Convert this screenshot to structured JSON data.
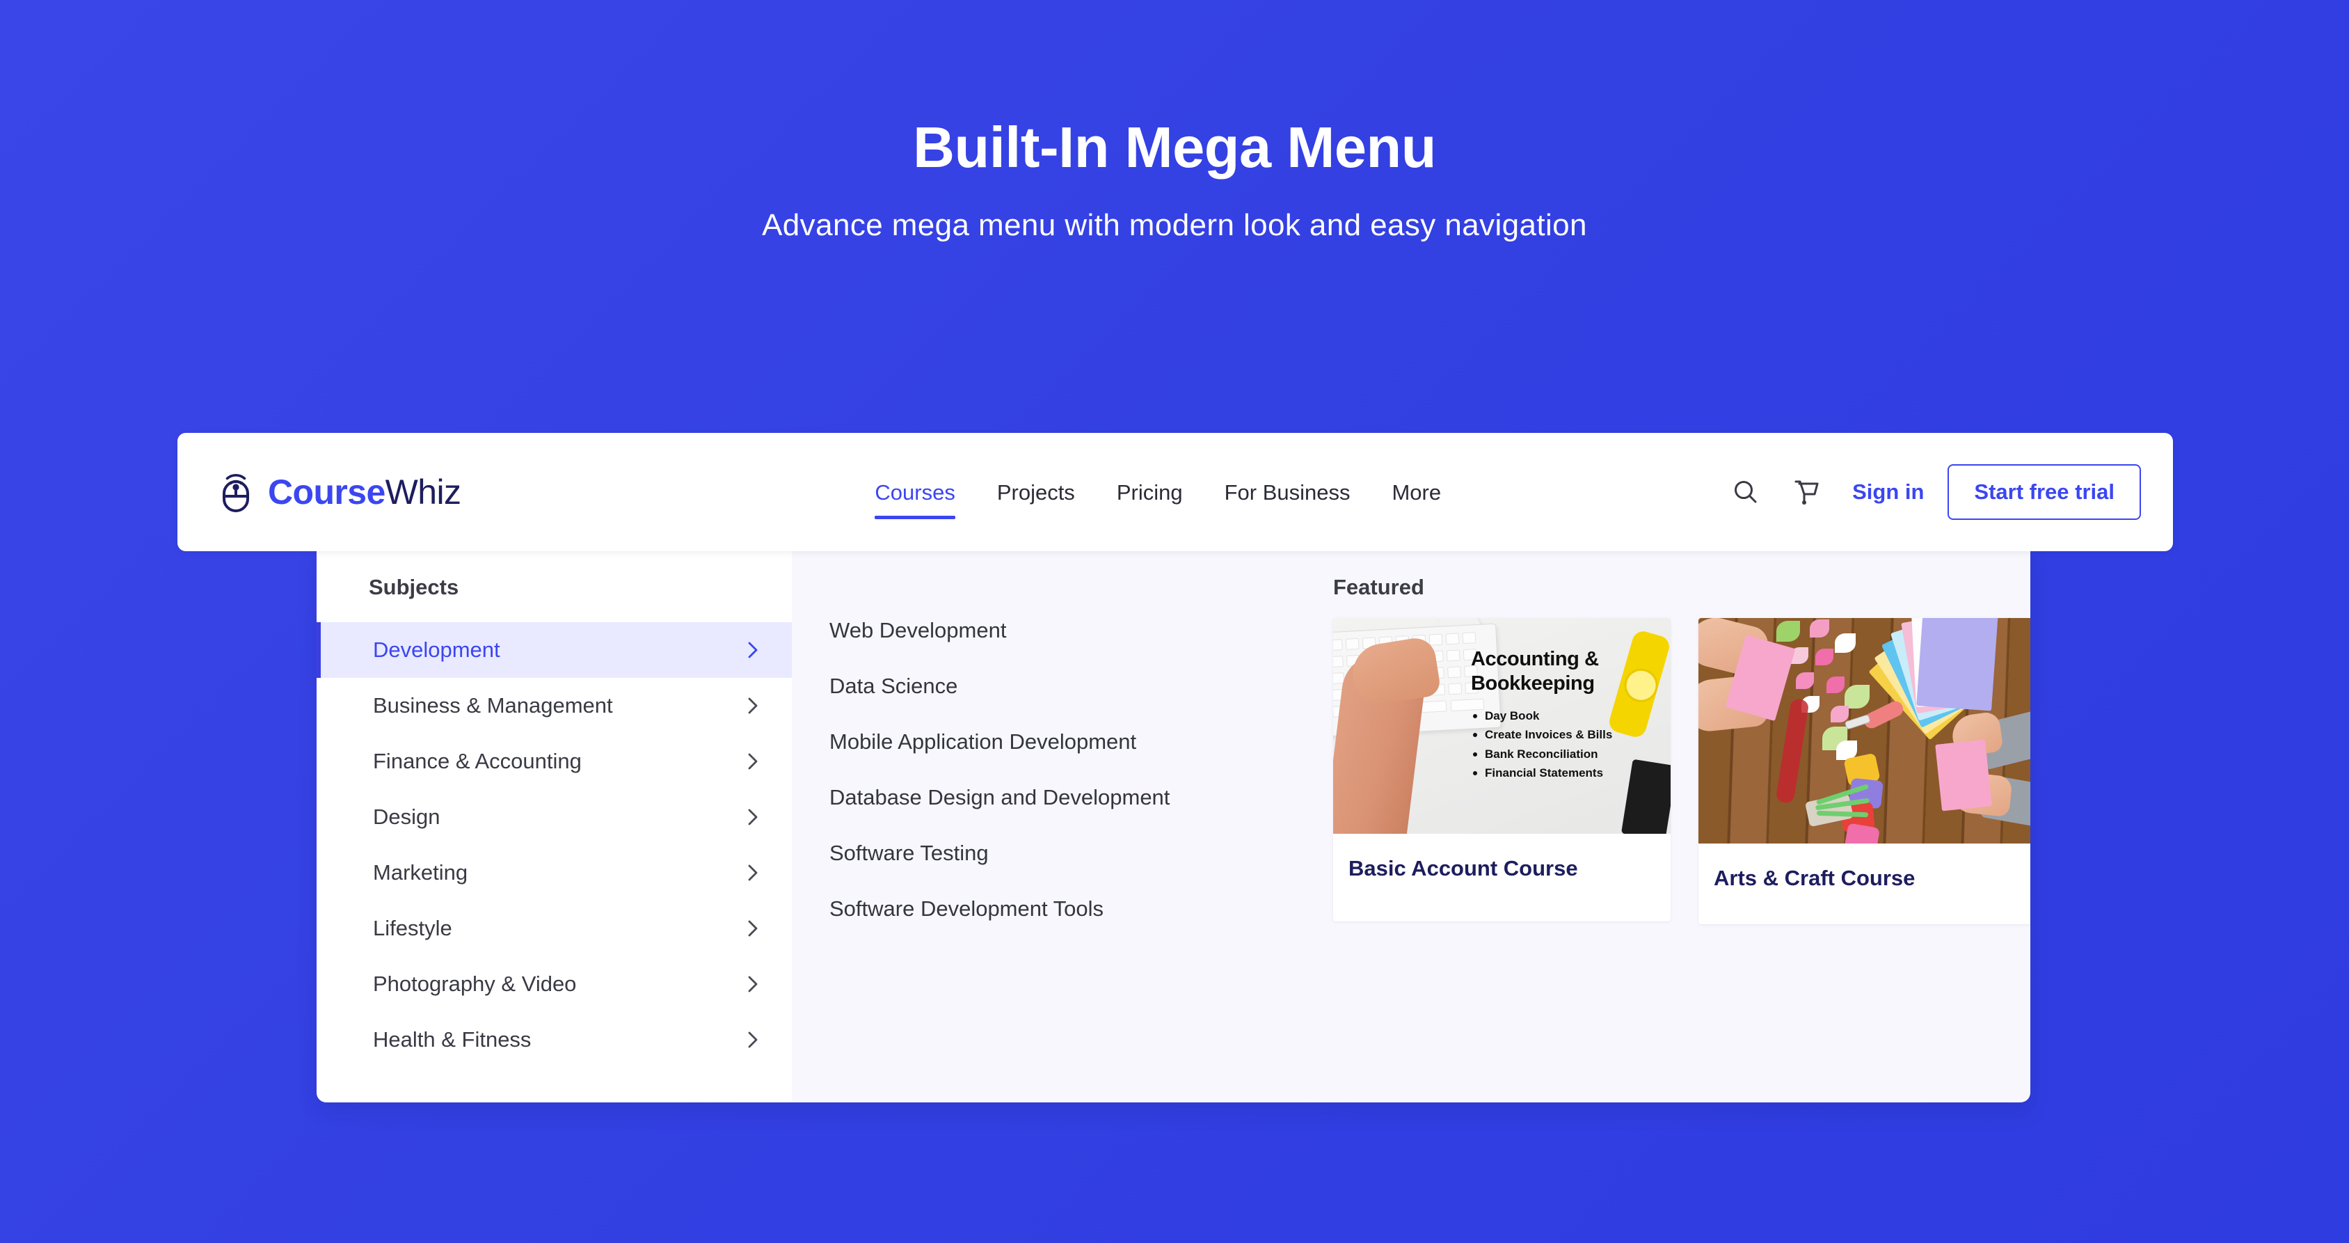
{
  "hero": {
    "title": "Built-In Mega Menu",
    "subtitle": "Advance mega menu with modern look and easy navigation"
  },
  "colors": {
    "page_background": "#3340E0",
    "accent": "#3B46F1",
    "logo_dark": "#1D1D5E",
    "active_row_background": "#E9EAFF",
    "panel_background": "#F7F7FD"
  },
  "header": {
    "logo": {
      "icon": "mouse-signal-icon",
      "text_primary": "Course",
      "text_secondary": "Whiz"
    },
    "nav_items": [
      {
        "label": "Courses",
        "active": true
      },
      {
        "label": "Projects",
        "active": false
      },
      {
        "label": "Pricing",
        "active": false
      },
      {
        "label": "For Business",
        "active": false
      },
      {
        "label": "More",
        "active": false
      }
    ],
    "icons": [
      {
        "name": "search-icon"
      },
      {
        "name": "cart-icon"
      }
    ],
    "sign_in_label": "Sign in",
    "trial_button_label": "Start free trial"
  },
  "mega_menu": {
    "subjects": {
      "heading": "Subjects",
      "items": [
        {
          "label": "Development",
          "active": true,
          "chevron": "chevron-right-icon"
        },
        {
          "label": "Business & Management",
          "active": false,
          "chevron": "chevron-right-icon"
        },
        {
          "label": "Finance & Accounting",
          "active": false,
          "chevron": "chevron-right-icon"
        },
        {
          "label": "Design",
          "active": false,
          "chevron": "chevron-right-icon"
        },
        {
          "label": "Marketing",
          "active": false,
          "chevron": "chevron-right-icon"
        },
        {
          "label": "Lifestyle",
          "active": false,
          "chevron": "chevron-right-icon"
        },
        {
          "label": "Photography & Video",
          "active": false,
          "chevron": "chevron-right-icon"
        },
        {
          "label": "Health & Fitness",
          "active": false,
          "chevron": "chevron-right-icon"
        }
      ]
    },
    "topics": [
      {
        "label": "Web Development"
      },
      {
        "label": "Data Science"
      },
      {
        "label": "Mobile Application Development"
      },
      {
        "label": "Database Design and Development"
      },
      {
        "label": "Software Testing"
      },
      {
        "label": "Software Development Tools"
      }
    ],
    "featured": {
      "heading": "Featured",
      "cards": [
        {
          "title": "Basic Account Course",
          "image_alt": "accounting-bookkeeping-desk-photo",
          "image_overlay_heading": "Accounting & Bookkeeping",
          "image_overlay_bullets": [
            "Day Book",
            "Create Invoices & Bills",
            "Bank Reconciliation",
            "Financial Statements"
          ]
        },
        {
          "title": "Arts & Craft Course",
          "image_alt": "arts-and-craft-paper-flowers-photo",
          "image_overlay_heading": "",
          "image_overlay_bullets": []
        }
      ]
    }
  }
}
